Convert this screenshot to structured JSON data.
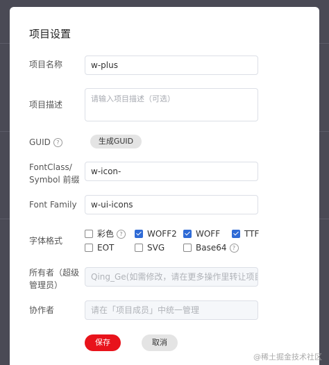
{
  "dialog": {
    "title": "项目设置"
  },
  "fields": {
    "name_label": "项目名称",
    "name_value": "w-plus",
    "desc_label": "项目描述",
    "desc_placeholder": "请输入项目描述（可选）",
    "guid_label": "GUID",
    "guid_button": "生成GUID",
    "fontclass_label_1": "FontClass/",
    "fontclass_label_2": "Symbol 前缀",
    "fontclass_value": "w-icon-",
    "fontfamily_label": "Font Family",
    "fontfamily_value": "w-ui-icons",
    "format_label": "字体格式",
    "owner_label_1": "所有者（超级",
    "owner_label_2": "管理员）",
    "owner_value": "Qing_Ge(如需修改，请在更多操作里转让项目)",
    "collab_label": "协作者",
    "collab_value": "请在「项目成员」中统一管理"
  },
  "formats": [
    {
      "label": "彩色",
      "checked": false,
      "help": true
    },
    {
      "label": "WOFF2",
      "checked": true,
      "help": false
    },
    {
      "label": "WOFF",
      "checked": true,
      "help": false
    },
    {
      "label": "TTF",
      "checked": true,
      "help": false
    },
    {
      "label": "EOT",
      "checked": false,
      "help": false
    },
    {
      "label": "SVG",
      "checked": false,
      "help": false
    },
    {
      "label": "Base64",
      "checked": false,
      "help": true
    }
  ],
  "help_glyph": "?",
  "buttons": {
    "save": "保存",
    "cancel": "取消"
  },
  "watermark": "@稀土掘金技术社区",
  "colors": {
    "primary": "#e8131b",
    "checkbox": "#2f6bd6"
  }
}
